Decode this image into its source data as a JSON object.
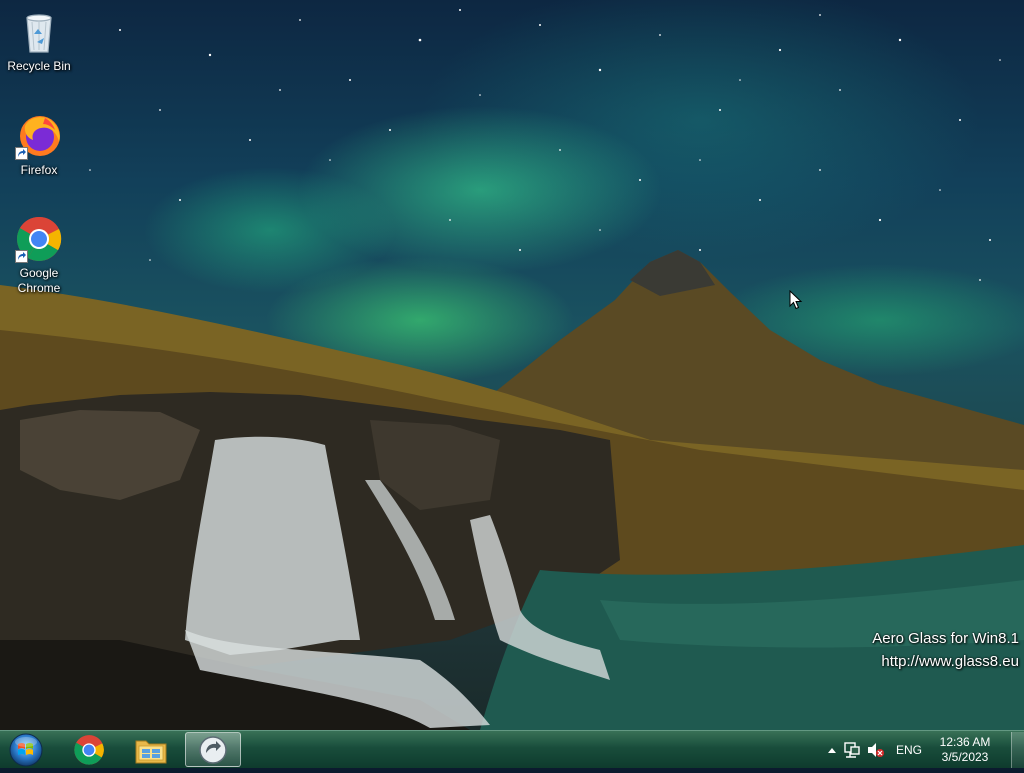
{
  "desktop": {
    "icons": [
      {
        "label": "Recycle Bin"
      },
      {
        "label": "Firefox"
      },
      {
        "label": "Google Chrome"
      }
    ],
    "watermark": {
      "line1": "Aero Glass for Win8.1",
      "line2": "http://www.glass8.eu"
    }
  },
  "taskbar": {
    "pinned": [
      "start-orb-icon",
      "chrome-icon",
      "file-explorer-icon",
      "app-icon"
    ],
    "tray": {
      "language": "ENG",
      "time": "12:36 AM",
      "date": "3/5/2023"
    }
  },
  "colors": {
    "taskbar": "#1f5a44",
    "aurora": "#3de694"
  }
}
